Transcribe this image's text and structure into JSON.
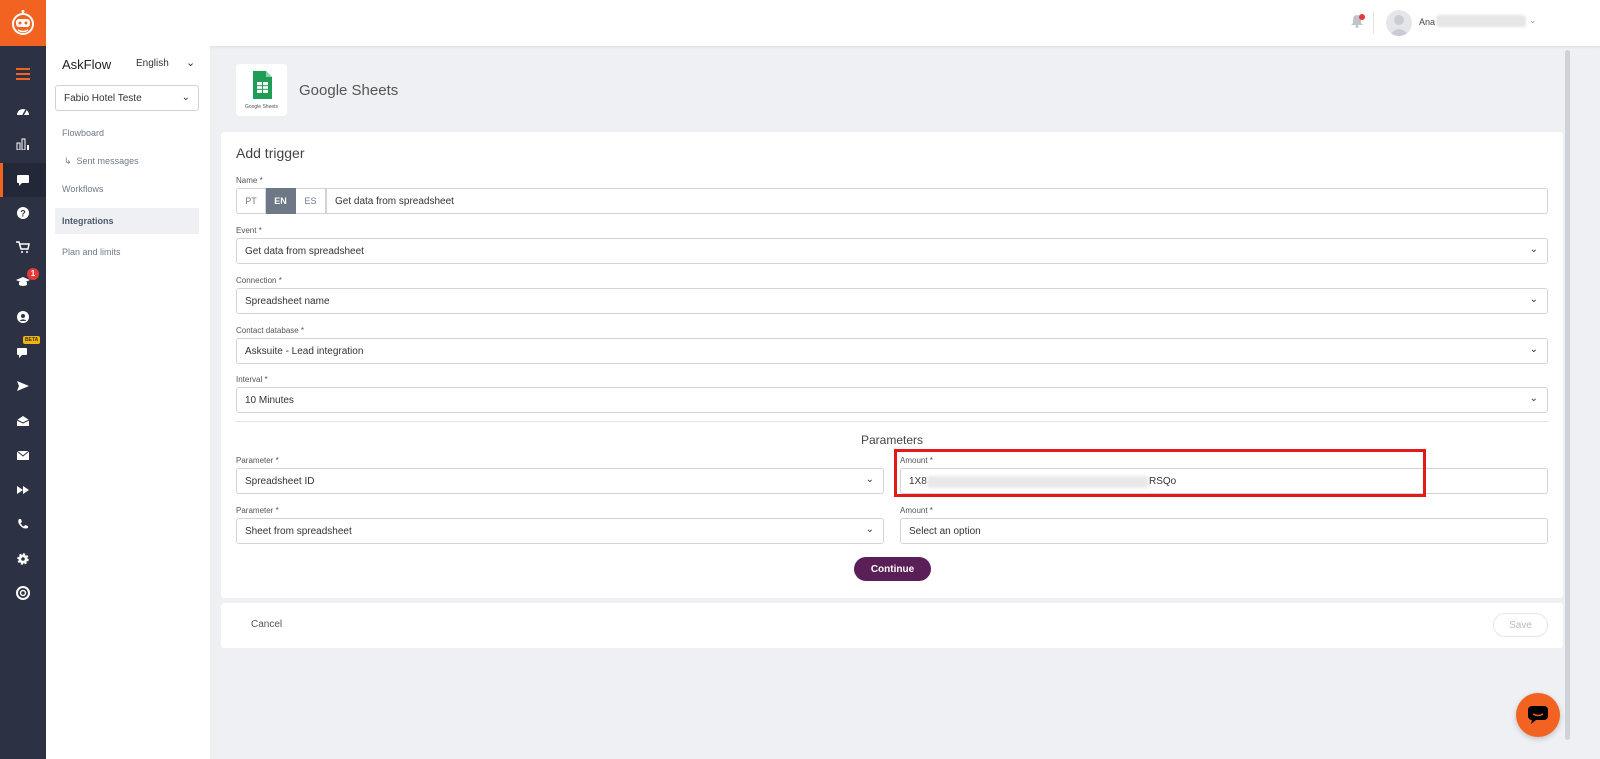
{
  "topbar": {
    "user_name": "Ana"
  },
  "rail": {
    "badge_count": "1",
    "beta_label": "BETA"
  },
  "subnav": {
    "title": "AskFlow",
    "language": "English",
    "hotel": "Fabio Hotel Teste",
    "links": {
      "flowboard": "Flowboard",
      "sent_messages": "Sent messages",
      "workflows": "Workflows",
      "integrations": "Integrations",
      "plan": "Plan and limits"
    }
  },
  "app": {
    "title": "Google Sheets",
    "icon_caption": "Google Sheets"
  },
  "form": {
    "title": "Add trigger",
    "name": {
      "label": "Name *",
      "langs": [
        "PT",
        "EN",
        "ES"
      ],
      "value": "Get data from spreadsheet"
    },
    "event": {
      "label": "Event *",
      "value": "Get data from spreadsheet"
    },
    "connection": {
      "label": "Connection *",
      "value": "Spreadsheet name"
    },
    "contact_db": {
      "label": "Contact database *",
      "value": "Asksuite - Lead integration"
    },
    "interval": {
      "label": "Interval *",
      "value": "10 Minutes"
    },
    "params_title": "Parameters",
    "params": [
      {
        "param_label": "Parameter *",
        "param_value": "Spreadsheet ID",
        "amount_label": "Amount *",
        "amount_prefix": "1X8",
        "amount_suffix": "RSQo"
      },
      {
        "param_label": "Parameter *",
        "param_value": "Sheet from spreadsheet",
        "amount_label": "Amount *",
        "amount_placeholder": "Select an option"
      }
    ],
    "continue": "Continue"
  },
  "footer": {
    "cancel": "Cancel",
    "save": "Save"
  },
  "colors": {
    "brand_orange": "#f26322",
    "rail_dark": "#2c3243",
    "continue_purple": "#5b1f57",
    "highlight_red": "#e01b1b",
    "sheets_green": "#1f9d55"
  }
}
